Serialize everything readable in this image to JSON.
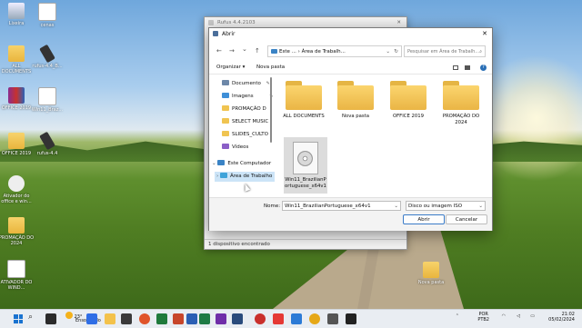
{
  "desktop": {
    "icons": [
      {
        "label": "Lixeira",
        "kind": "bin"
      },
      {
        "label": "cenas",
        "kind": "file"
      },
      {
        "label": "ALL DOCUMENTS",
        "kind": "folder"
      },
      {
        "label": "rufus-4.4_B...",
        "kind": "usb"
      },
      {
        "label": "OFFICE 2019",
        "kind": "rar"
      },
      {
        "label": "Win11_Braz...",
        "kind": "file"
      },
      {
        "label": "OFFICE 2019",
        "kind": "folder"
      },
      {
        "label": "rufus-4.4",
        "kind": "usb"
      },
      {
        "label": "Ativador do office e win...",
        "kind": "gear"
      },
      {
        "label": "PROMAÇÃO DO 2024",
        "kind": "folder"
      },
      {
        "label": "ATIVADOR DO WIND...",
        "kind": "file"
      },
      {
        "label": "Nova pasta",
        "kind": "folder"
      }
    ]
  },
  "rufus": {
    "title": "Rufus 4.4.2103",
    "close": "✕",
    "status": "1 dispositivo encontrado"
  },
  "dialog": {
    "title": "Abrir",
    "close": "✕",
    "nav": {
      "back": "←",
      "forward": "→",
      "down": "⌄",
      "up": "↑"
    },
    "address": {
      "parts": "Este ...  ›  Área de Trabalh...",
      "dropdown": "⌄",
      "refresh": "↻"
    },
    "search_placeholder": "Pesquisar em Área de Trabalh...",
    "search_icon": "⌕",
    "organize": "Organizar ▾",
    "new_folder": "Nova pasta",
    "help": "?",
    "nav_items": [
      {
        "label": "Documento",
        "icon": "document-icon",
        "pinned": true
      },
      {
        "label": "Imagens",
        "icon": "pictures-icon",
        "pinned": true
      },
      {
        "label": "PROMAÇÃO D",
        "icon": "folder-icon",
        "pinned": false
      },
      {
        "label": "SELECT MUSIC",
        "icon": "folder-icon",
        "pinned": false
      },
      {
        "label": "SLIDES_CULTO",
        "icon": "folder-icon",
        "pinned": false
      },
      {
        "label": "Vídeos",
        "icon": "videos-icon",
        "pinned": false
      },
      {
        "label": "Este Computador",
        "icon": "computer-icon",
        "pinned": false
      },
      {
        "label": "Área de Trabalho",
        "icon": "desktop-icon",
        "pinned": false
      }
    ],
    "pin_glyph": "✎",
    "items": [
      {
        "label": "ALL DOCUMENTS",
        "type": "folder"
      },
      {
        "label": "Nova pasta",
        "type": "folder"
      },
      {
        "label": "OFFICE 2019",
        "type": "folder"
      },
      {
        "label": "PROMAÇÃO DO 2024",
        "type": "folder"
      },
      {
        "label": "Win11_BrazilianPortuguese_x64v1",
        "type": "disc-image"
      }
    ],
    "name_label": "Nome:",
    "name_value": "Win11_BrazilianPortuguese_x64v1",
    "filetype_value": "Disco ou imagem ISO",
    "open_button": "Abrir",
    "cancel_button": "Cancelar"
  },
  "taskbar": {
    "weather_temp": "23°",
    "weather_desc": "Ensolarado",
    "lang": "POR",
    "layout": "PTB2",
    "time": "21:02",
    "date": "05/02/2024"
  }
}
